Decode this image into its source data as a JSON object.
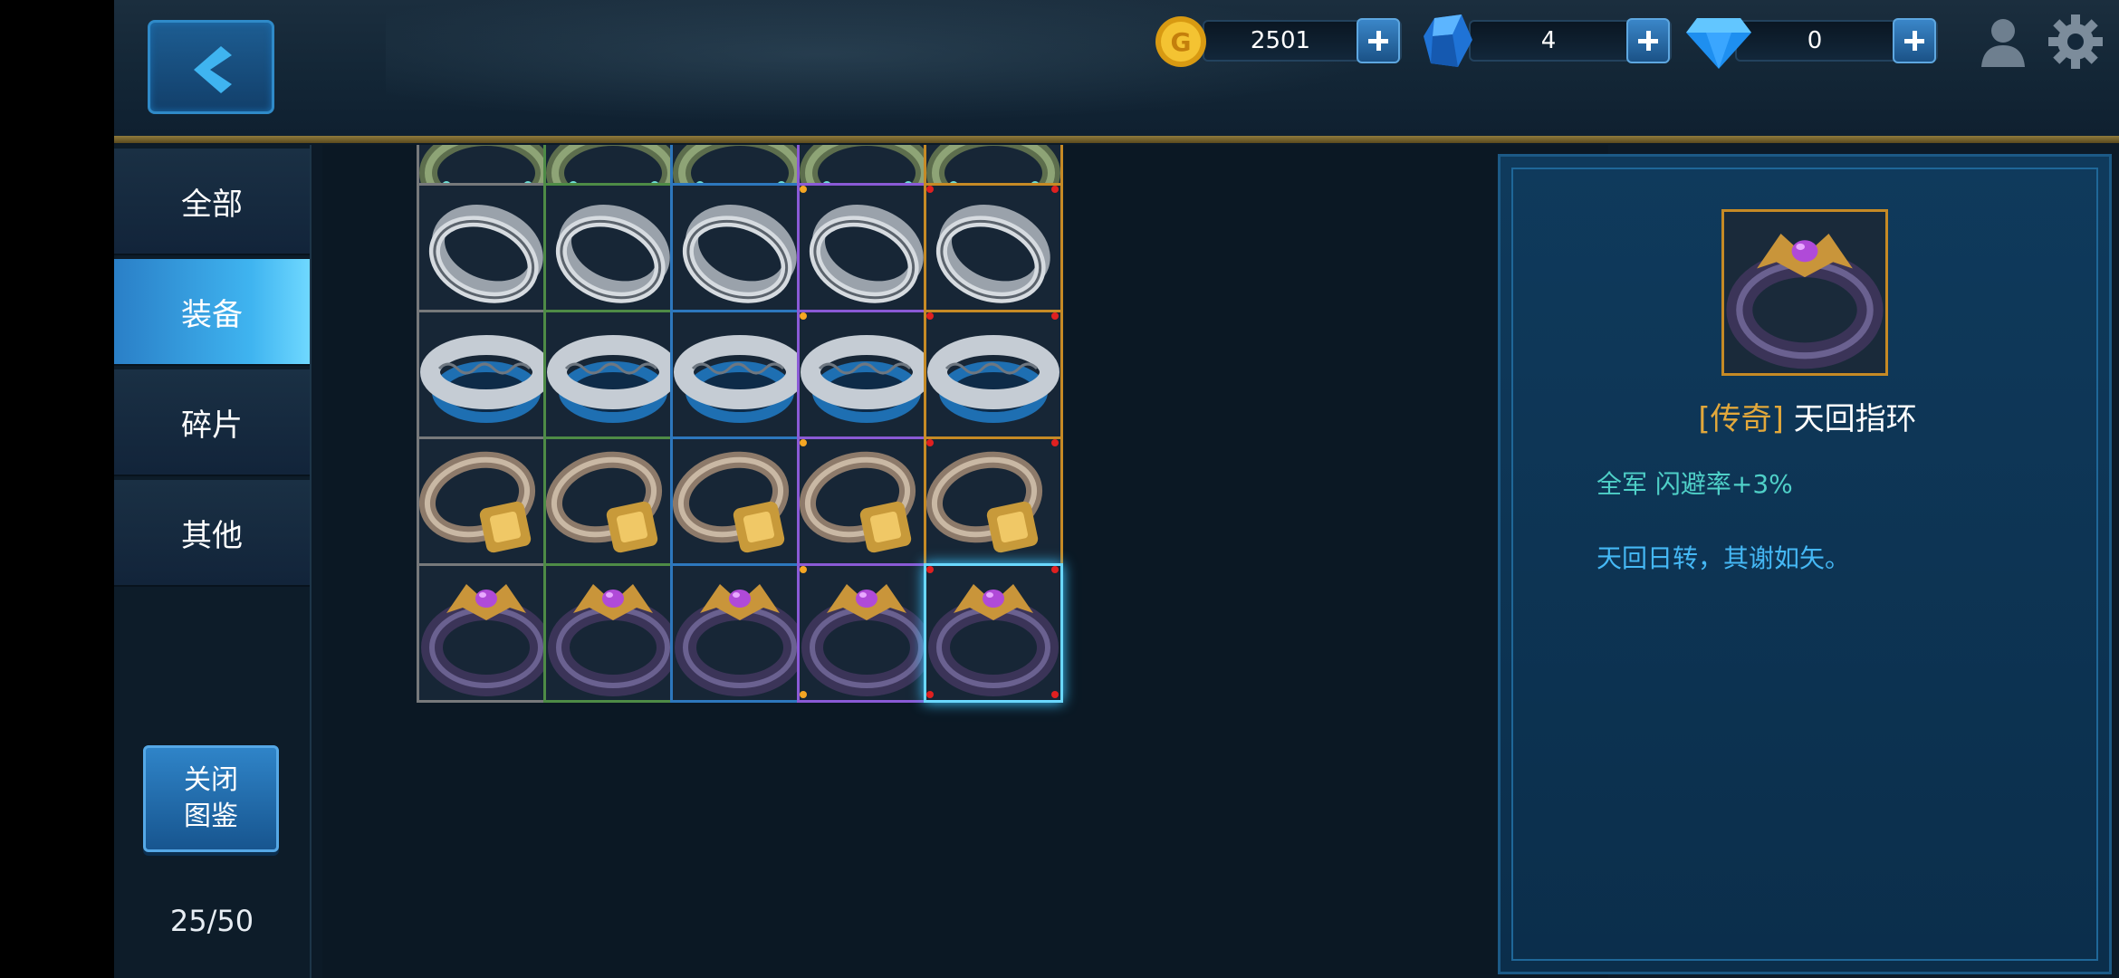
{
  "resources": {
    "gold": "2501",
    "crystal": "4",
    "diamond": "0"
  },
  "tabs": [
    "全部",
    "装备",
    "碎片",
    "其他"
  ],
  "active_tab": "装备",
  "close_button": {
    "line1": "关闭",
    "line2": "图鉴"
  },
  "page_count": "25/50",
  "quality_colors": {
    "grey": "#77797b",
    "green": "#4e8b46",
    "blue": "#2d77bd",
    "purple": "#8a5ad6",
    "orange": "#c68a25",
    "selected": "#6ad8ff"
  },
  "grid": {
    "rows": [
      {
        "item": "green-jeweled-band",
        "qualities": [
          "grey",
          "green",
          "blue",
          "purple",
          "orange"
        ]
      },
      {
        "item": "silver-double-ring",
        "qualities": [
          "grey",
          "green",
          "blue",
          "purple",
          "orange"
        ]
      },
      {
        "item": "wave-engraved-ring",
        "qualities": [
          "grey",
          "green",
          "blue",
          "purple",
          "orange"
        ]
      },
      {
        "item": "gold-signet-ring",
        "qualities": [
          "grey",
          "green",
          "blue",
          "purple",
          "orange"
        ]
      },
      {
        "item": "dark-gem-ring",
        "qualities": [
          "grey",
          "green",
          "blue",
          "purple",
          "orange"
        ]
      }
    ],
    "selected": {
      "row": 4,
      "col": 4
    }
  },
  "detail": {
    "rarity": "[传奇]",
    "name": "天回指环",
    "stat": "全军 闪避率+3%",
    "description": "天回日转，其谢如矢。"
  }
}
